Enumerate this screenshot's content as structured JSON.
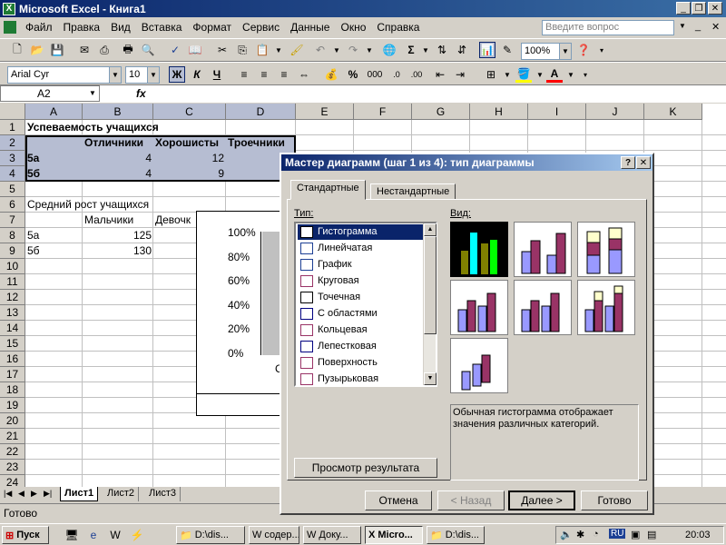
{
  "window": {
    "title": "Microsoft Excel - Книга1"
  },
  "menu": {
    "items": [
      "Файл",
      "Правка",
      "Вид",
      "Вставка",
      "Формат",
      "Сервис",
      "Данные",
      "Окно",
      "Справка"
    ],
    "ask_placeholder": "Введите вопрос"
  },
  "toolbar": {
    "zoom": "100%",
    "font": "Arial Cyr",
    "size": "10",
    "bold": "Ж",
    "italic": "К",
    "underline": "Ч"
  },
  "formula": {
    "namebox": "A2",
    "fx": "fx"
  },
  "grid": {
    "columns": [
      "A",
      "B",
      "C",
      "D",
      "E",
      "F",
      "G",
      "H",
      "I",
      "J",
      "K"
    ],
    "rows": [
      "1",
      "2",
      "3",
      "4",
      "5",
      "6",
      "7",
      "8",
      "9",
      "10",
      "11",
      "12",
      "13",
      "14",
      "15",
      "16",
      "17",
      "18",
      "19",
      "20",
      "21",
      "22",
      "23",
      "24"
    ],
    "table1_title": "Успеваемость учащихся",
    "table1_headers": [
      "Отличники",
      "Хорошисты",
      "Троечники"
    ],
    "table1_rows": [
      {
        "label": "5а",
        "values": [
          "4",
          "12"
        ]
      },
      {
        "label": "5б",
        "values": [
          "4",
          "9"
        ]
      }
    ],
    "table2_title": "Средний рост учащихся",
    "table2_headers": [
      "Мальчики",
      "Девочк"
    ],
    "table2_rows": [
      {
        "label": "5а",
        "value": "125"
      },
      {
        "label": "5б",
        "value": "130"
      }
    ],
    "chart_axis": [
      "100%",
      "80%",
      "60%",
      "40%",
      "20%",
      "0%"
    ],
    "chart_partial_label": "С"
  },
  "sheets": {
    "tabs": [
      "Лист1",
      "Лист2",
      "Лист3"
    ]
  },
  "status": {
    "text": "Готово"
  },
  "taskbar": {
    "start": "Пуск",
    "tasks": [
      "D:\\dis...",
      "содер...",
      "Доку...",
      "Micro...",
      "D:\\dis..."
    ],
    "lang": "RU",
    "time": "20:03"
  },
  "dialog": {
    "title": "Мастер диаграмм (шаг 1 из 4): тип диаграммы",
    "tabs": [
      "Стандартные",
      "Нестандартные"
    ],
    "type_label": "Тип:",
    "view_label": "Вид:",
    "types": [
      "Гистограмма",
      "Линейчатая",
      "График",
      "Круговая",
      "Точечная",
      "С областями",
      "Кольцевая",
      "Лепестковая",
      "Поверхность",
      "Пузырьковая"
    ],
    "description": "Обычная гистограмма отображает значения различных категорий.",
    "preview_button": "Просмотр результата",
    "buttons": {
      "cancel": "Отмена",
      "back": "< Назад",
      "next": "Далее >",
      "finish": "Готово"
    },
    "help": "?",
    "close": "✕"
  },
  "colors": {
    "bar1": "#9999ff",
    "bar2": "#993366",
    "bar3": "#ffffcc",
    "selected_bg": "#0a246a",
    "thumb_dark": "#000000"
  }
}
